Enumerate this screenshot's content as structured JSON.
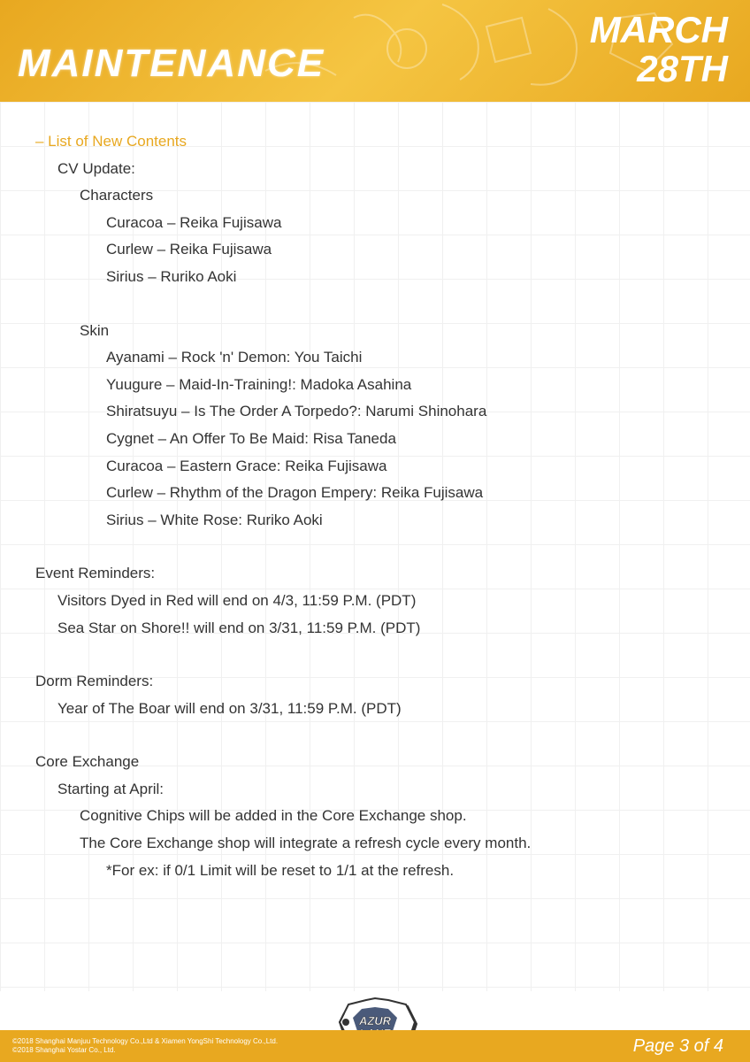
{
  "header": {
    "title": "MAINTENANCE",
    "date_line1": "MARCH",
    "date_line2": "28TH"
  },
  "content": {
    "section_title": "– List of New Contents",
    "cv_update_label": "CV Update:",
    "characters_label": "Characters",
    "characters": [
      "Curacoa – Reika Fujisawa",
      "Curlew – Reika Fujisawa",
      "Sirius – Ruriko Aoki"
    ],
    "skin_label": "Skin",
    "skins": [
      "Ayanami – Rock 'n' Demon: You Taichi",
      "Yuugure – Maid-In-Training!: Madoka Asahina",
      "Shiratsuyu – Is The Order A Torpedo?: Narumi Shinohara",
      "Cygnet – An Offer To Be Maid: Risa Taneda",
      "Curacoa – Eastern Grace: Reika Fujisawa",
      "Curlew – Rhythm of the Dragon Empery: Reika Fujisawa",
      "Sirius – White Rose: Ruriko Aoki"
    ],
    "event_reminders_label": "Event Reminders:",
    "event_reminders": [
      "Visitors Dyed in Red will end on 4/3, 11:59 P.M. (PDT)",
      "Sea Star on Shore!! will end on 3/31, 11:59 P.M. (PDT)"
    ],
    "dorm_reminders_label": "Dorm Reminders:",
    "dorm_reminders": [
      "Year of The Boar will end on 3/31, 11:59 P.M. (PDT)"
    ],
    "core_exchange_label": "Core Exchange",
    "core_exchange_sub": "Starting at April:",
    "core_exchange_items": [
      "Cognitive Chips will be added in the Core Exchange shop.",
      "The Core Exchange shop will integrate a refresh cycle every month."
    ],
    "core_exchange_note": "*For ex: if 0/1 Limit will be reset to 1/1 at the refresh."
  },
  "footer": {
    "copyright_line1": "©2018 Shanghai Manjuu Technology Co.,Ltd & Xiamen YongShi Technology Co.,Ltd.",
    "copyright_line2": "©2018 Shanghai Yostar Co., Ltd.",
    "page": "Page 3 of 4",
    "logo_text": "AZUR LANE"
  }
}
